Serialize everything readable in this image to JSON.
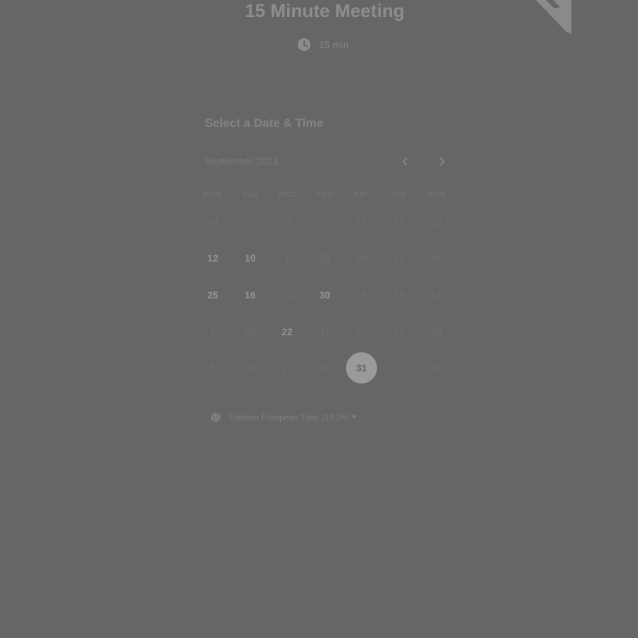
{
  "event": {
    "title": "15 Minute Meeting",
    "duration": "15 min",
    "duration_icon": "clock-icon"
  },
  "scheduler": {
    "heading": "Select a Date & Time",
    "month_label": "September 2021",
    "prev_icon": "chevron-left-icon",
    "next_icon": "chevron-right-icon",
    "weekdays": [
      "MON",
      "TUE",
      "WED",
      "THU",
      "FRI",
      "SAT",
      "SUN"
    ],
    "weeks": [
      [
        {
          "d": "14",
          "s": "off"
        },
        {
          "d": "1",
          "s": "off"
        },
        {
          "d": "20",
          "s": "off"
        },
        {
          "d": "17",
          "s": "off"
        },
        {
          "d": "13",
          "s": "off"
        },
        {
          "d": "21",
          "s": "off"
        },
        {
          "d": "29",
          "s": "off"
        }
      ],
      [
        {
          "d": "12",
          "s": "avail"
        },
        {
          "d": "10",
          "s": "avail"
        },
        {
          "d": "1",
          "s": "off"
        },
        {
          "d": "28",
          "s": "off"
        },
        {
          "d": "26",
          "s": "off"
        },
        {
          "d": "24",
          "s": "off"
        },
        {
          "d": "24",
          "s": "off"
        }
      ],
      [
        {
          "d": "25",
          "s": "avail"
        },
        {
          "d": "16",
          "s": "avail"
        },
        {
          "d": "24",
          "s": "off"
        },
        {
          "d": "30",
          "s": "avail"
        },
        {
          "d": "15",
          "s": "off"
        },
        {
          "d": "19",
          "s": "off"
        },
        {
          "d": "12",
          "s": "off"
        }
      ],
      [
        {
          "d": "3",
          "s": "off"
        },
        {
          "d": "25",
          "s": "off"
        },
        {
          "d": "22",
          "s": "avail"
        },
        {
          "d": "31",
          "s": "off"
        },
        {
          "d": "10",
          "s": "off"
        },
        {
          "d": "23",
          "s": "off"
        },
        {
          "d": "30",
          "s": "off"
        }
      ],
      [
        {
          "d": "5",
          "s": "off"
        },
        {
          "d": "10",
          "s": "off"
        },
        {
          "d": "10",
          "s": "off"
        },
        {
          "d": "30",
          "s": "off"
        },
        {
          "d": "31",
          "s": "selected"
        },
        {
          "d": "9",
          "s": "off"
        },
        {
          "d": "19",
          "s": "off"
        }
      ]
    ]
  },
  "timezone": {
    "label": "Eastern European Time (13:26)",
    "icon": "globe-icon",
    "caret_icon": "caret-down-icon"
  },
  "colors": {
    "backdrop": "#666666",
    "selected_day": "#9a9a9a",
    "available_day": "#939393",
    "unavailable_day": "#6e6e6e"
  }
}
